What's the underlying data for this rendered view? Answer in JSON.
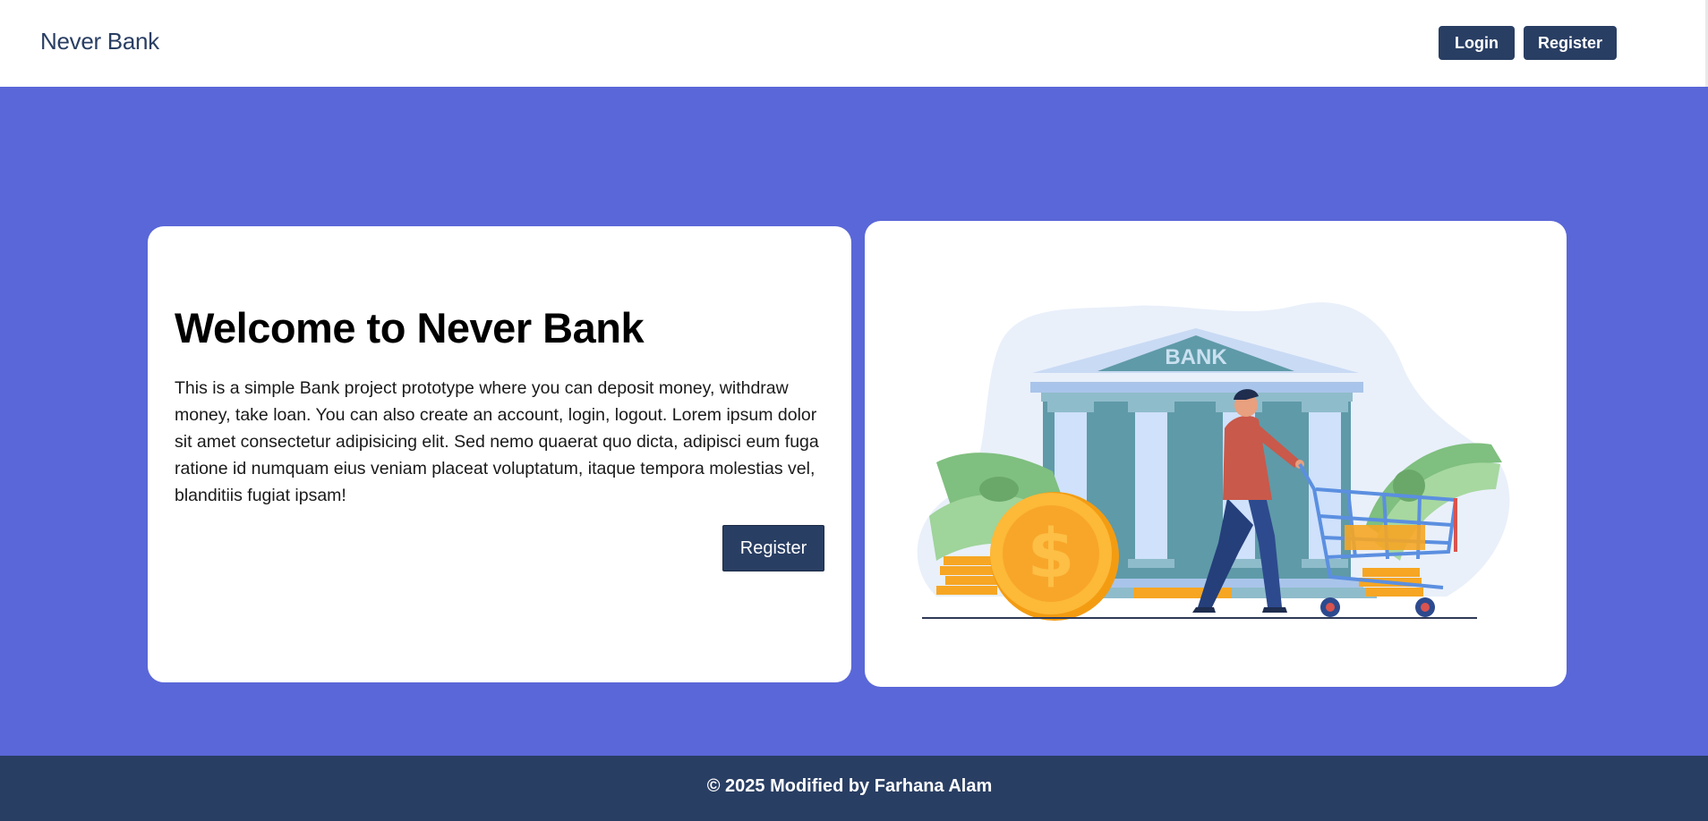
{
  "nav": {
    "brand": "Never Bank",
    "login_label": "Login",
    "register_label": "Register"
  },
  "hero": {
    "title": "Welcome to Never Bank",
    "description": "This is a simple Bank project prototype where you can deposit money, withdraw money, take loan. You can also create an account, login, logout. Lorem ipsum dolor sit amet consectetur adipisicing elit. Sed nemo quaerat quo dicta, adipisci eum fuga ratione id numquam eius veniam placeat voluptatum, itaque tempora molestias vel, blanditiis fugiat ipsam!",
    "register_label": "Register"
  },
  "illustration": {
    "bank_sign": "BANK"
  },
  "footer": {
    "text": "© 2025 Modified by Farhana Alam"
  },
  "colors": {
    "navy": "#293e63",
    "hero_bg": "#5a67d8",
    "card_bg": "#ffffff"
  }
}
